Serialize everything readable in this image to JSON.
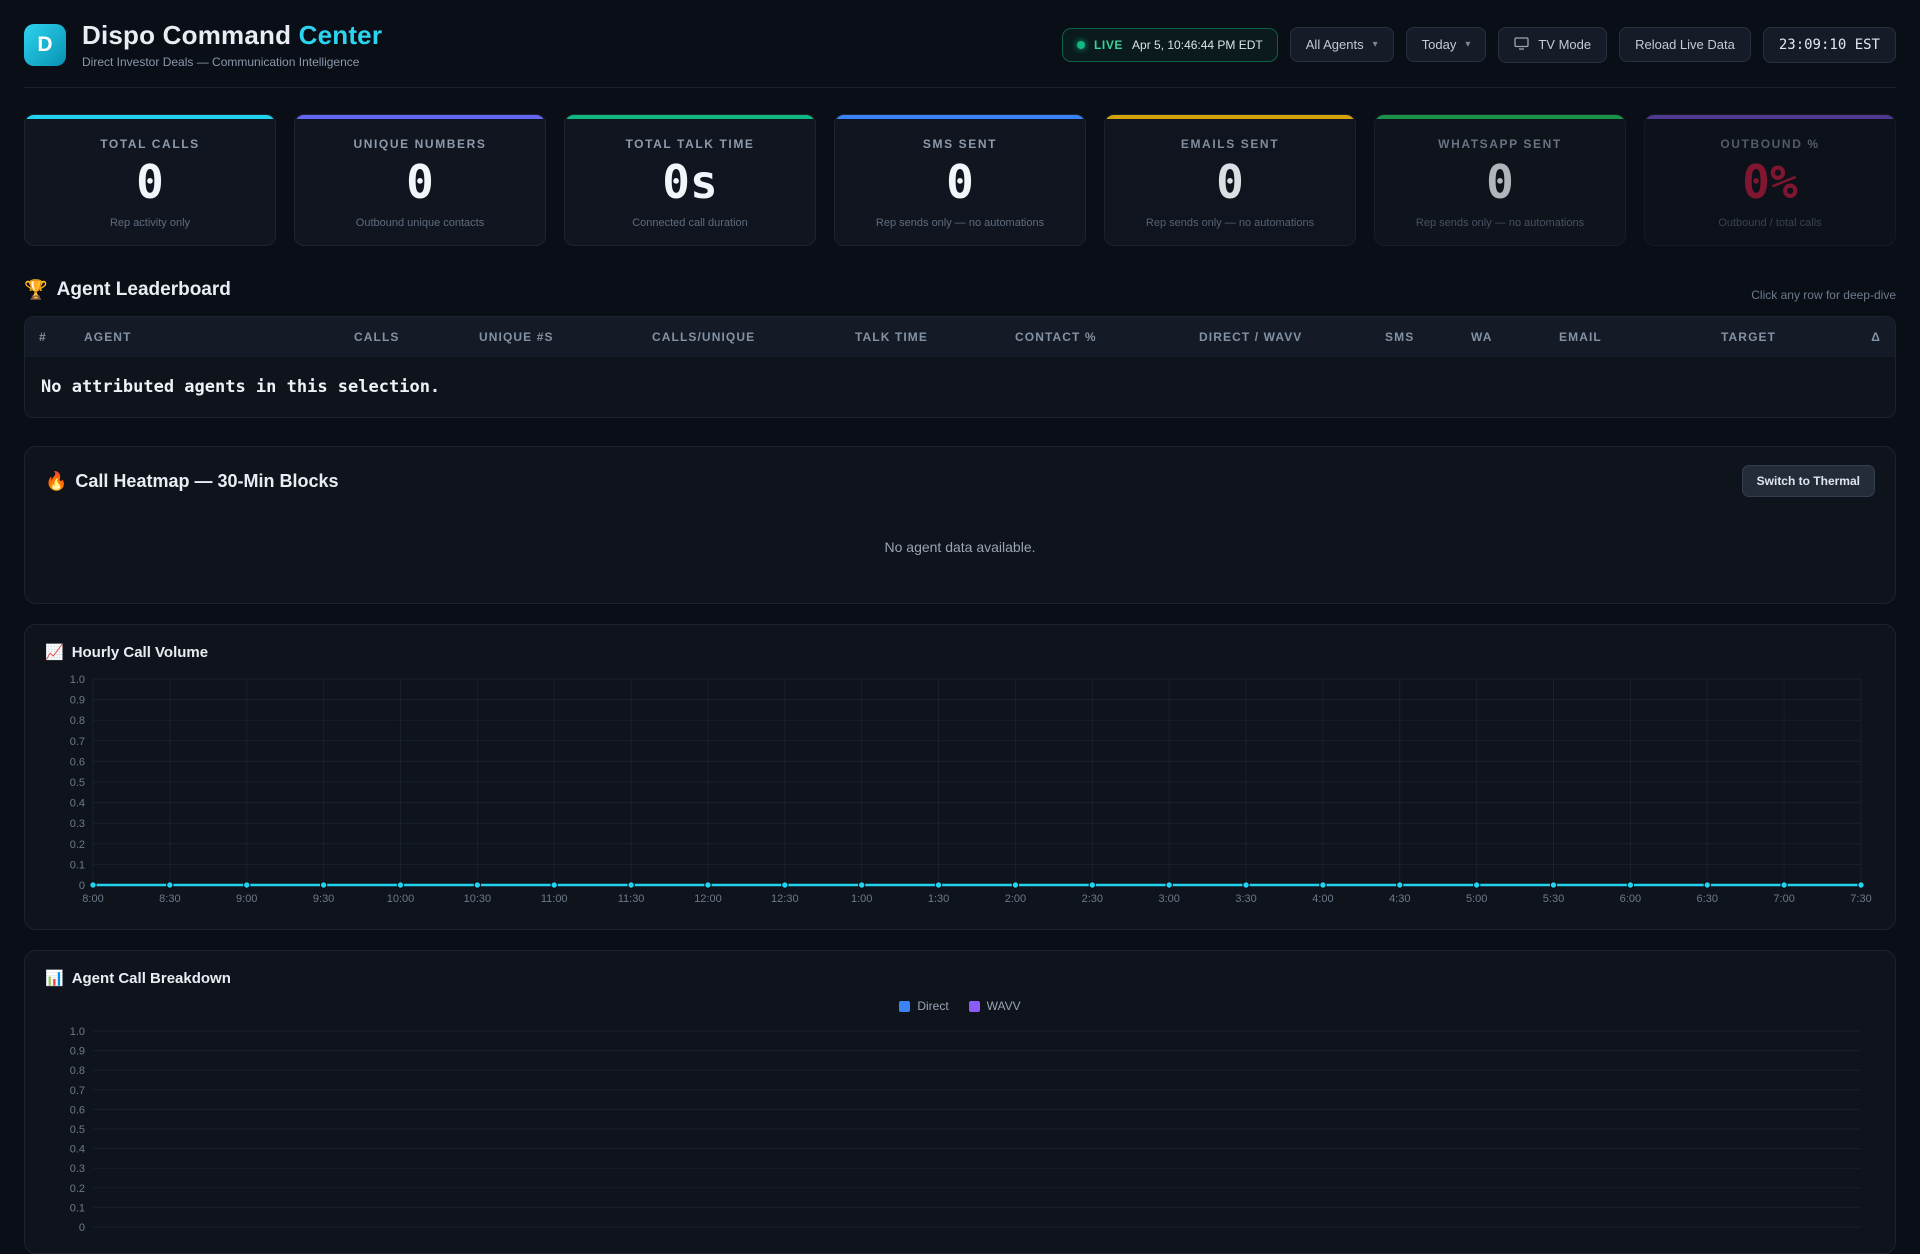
{
  "header": {
    "logo_letter": "D",
    "title_main": "Dispo Command",
    "title_accent": "Center",
    "subtitle": "Direct Investor Deals — Communication Intelligence",
    "live_label": "LIVE",
    "live_timestamp": "Apr 5, 10:46:44 PM EDT",
    "agents_filter": "All Agents",
    "date_filter": "Today",
    "tv_mode_label": "TV Mode",
    "reload_label": "Reload Live Data",
    "clock": "23:09:10 EST"
  },
  "kpis": [
    {
      "label": "TOTAL CALLS",
      "value": "0",
      "sub": "Rep activity only",
      "accent": "#22d3ee"
    },
    {
      "label": "UNIQUE NUMBERS",
      "value": "0",
      "sub": "Outbound unique contacts",
      "accent": "#6366f1"
    },
    {
      "label": "TOTAL TALK TIME",
      "value": "0s",
      "sub": "Connected call duration",
      "accent": "#10b981"
    },
    {
      "label": "SMS SENT",
      "value": "0",
      "sub": "Rep sends only — no automations",
      "accent": "#3b82f6"
    },
    {
      "label": "EMAILS SENT",
      "value": "0",
      "sub": "Rep sends only — no automations",
      "accent": "#eab308"
    },
    {
      "label": "WHATSAPP SENT",
      "value": "0",
      "sub": "Rep sends only — no automations",
      "accent": "#22c55e"
    },
    {
      "label": "OUTBOUND %",
      "value": "0%",
      "sub": "Outbound / total calls",
      "accent": "#8b5cf6",
      "value_color": "#e11d48"
    }
  ],
  "leaderboard": {
    "icon": "🏆",
    "title": "Agent Leaderboard",
    "hint": "Click any row for deep-dive",
    "columns": [
      "#",
      "AGENT",
      "CALLS",
      "UNIQUE #S",
      "CALLS/UNIQUE",
      "TALK TIME",
      "CONTACT %",
      "DIRECT / WAVV",
      "SMS",
      "WA",
      "EMAIL",
      "TARGET",
      "Δ"
    ],
    "empty_message": "No attributed agents in this selection."
  },
  "heatmap": {
    "icon": "🔥",
    "title": "Call Heatmap — 30-Min Blocks",
    "toggle_label": "Switch to Thermal",
    "empty_message": "No agent data available."
  },
  "hourly": {
    "icon": "📈",
    "title": "Hourly Call Volume"
  },
  "breakdown": {
    "icon": "📊",
    "title": "Agent Call Breakdown",
    "legend": [
      {
        "label": "Direct",
        "color": "#3b82f6"
      },
      {
        "label": "WAVV",
        "color": "#8b5cf6"
      }
    ]
  },
  "chart_data": [
    {
      "type": "line",
      "title": "Hourly Call Volume",
      "x": [
        "8:00",
        "8:30",
        "9:00",
        "9:30",
        "10:00",
        "10:30",
        "11:00",
        "11:30",
        "12:00",
        "12:30",
        "1:00",
        "1:30",
        "2:00",
        "2:30",
        "3:00",
        "3:30",
        "4:00",
        "4:30",
        "5:00",
        "5:30",
        "6:00",
        "6:30",
        "7:00",
        "7:30"
      ],
      "series": [
        {
          "name": "Calls",
          "color": "#22d3ee",
          "values": [
            0,
            0,
            0,
            0,
            0,
            0,
            0,
            0,
            0,
            0,
            0,
            0,
            0,
            0,
            0,
            0,
            0,
            0,
            0,
            0,
            0,
            0,
            0,
            0
          ]
        }
      ],
      "ylim": [
        0,
        1.0
      ],
      "ytick_step": 0.1,
      "grid": true,
      "legend_position": "none"
    },
    {
      "type": "bar",
      "title": "Agent Call Breakdown",
      "categories": [],
      "series": [
        {
          "name": "Direct",
          "color": "#3b82f6",
          "values": []
        },
        {
          "name": "WAVV",
          "color": "#8b5cf6",
          "values": []
        }
      ],
      "ylim": [
        0,
        1.0
      ],
      "ytick_step": 0.1,
      "grid": true,
      "legend_position": "top-center"
    }
  ]
}
